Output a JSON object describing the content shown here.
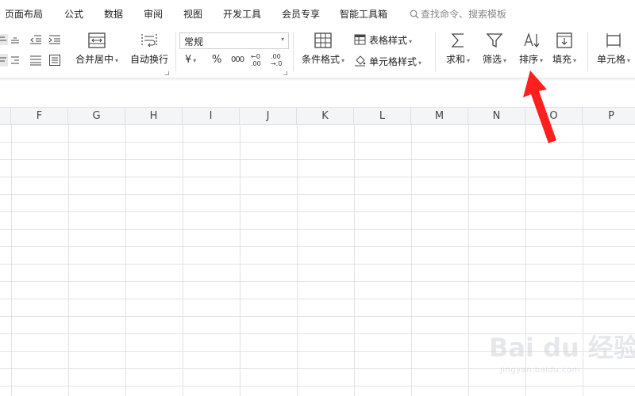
{
  "menu": {
    "items": [
      "页面布局",
      "公式",
      "数据",
      "审阅",
      "视图",
      "开发工具",
      "会员专享",
      "智能工具箱"
    ],
    "search_placeholder": "查找命令、搜索模板"
  },
  "ribbon": {
    "merge_center": "合并居中",
    "wrap_text": "自动换行",
    "number_format": "常规",
    "currency_symbol": "¥",
    "percent_symbol": "%",
    "thousands_symbol": "000",
    "increase_decimal": "←0 .00",
    "decrease_decimal": ".00 →.0",
    "conditional_format": "条件格式",
    "table_style": "表格样式",
    "cell_style": "单元格样式",
    "sum": "求和",
    "filter": "筛选",
    "sort": "排序",
    "fill": "填充",
    "cell": "单元格"
  },
  "grid": {
    "columns": [
      "F",
      "G",
      "H",
      "I",
      "J",
      "K",
      "L",
      "M",
      "N",
      "O",
      "P"
    ]
  },
  "annotation": {
    "arrow_color": "#ff1f1f"
  },
  "watermark": {
    "main": "Bai du 经验",
    "sub": "jingyan.baidu.com"
  },
  "colors": {
    "header_bg": "#f3f5f7",
    "grid_line": "#e0e3e7"
  }
}
